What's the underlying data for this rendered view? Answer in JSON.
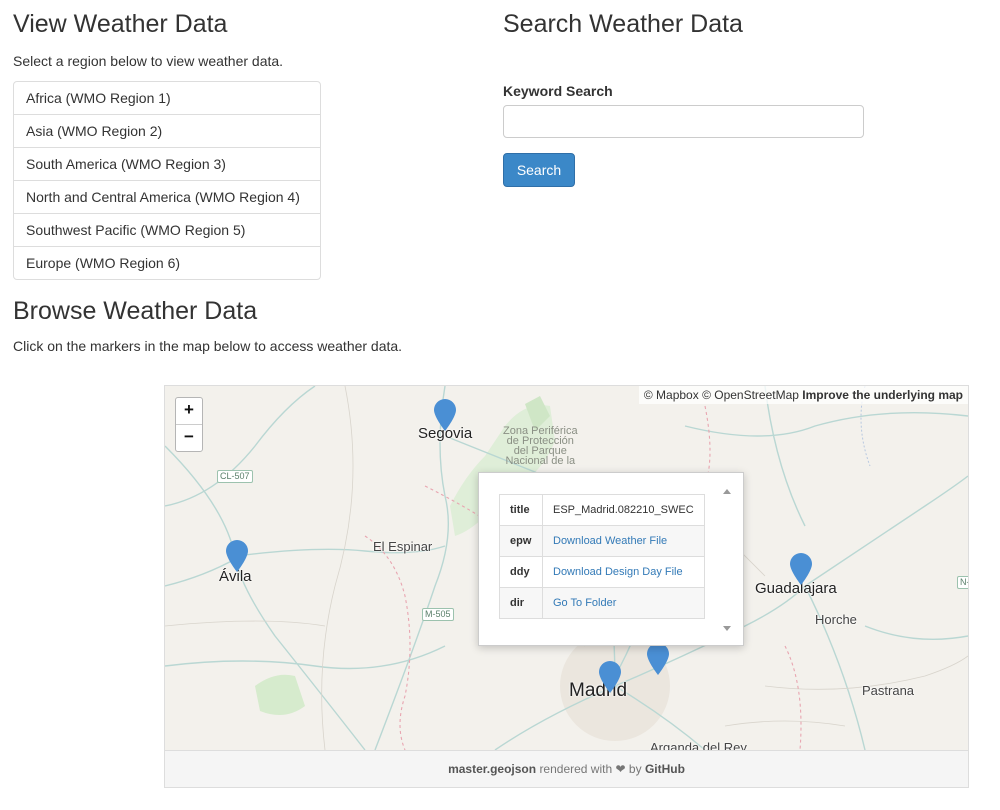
{
  "view": {
    "title": "View Weather Data",
    "subtitle": "Select a region below to view weather data.",
    "regions": [
      "Africa (WMO Region 1)",
      "Asia (WMO Region 2)",
      "South America (WMO Region 3)",
      "North and Central America (WMO Region 4)",
      "Southwest Pacific (WMO Region 5)",
      "Europe (WMO Region 6)"
    ]
  },
  "search": {
    "title": "Search Weather Data",
    "keyword_label": "Keyword Search",
    "input_value": "",
    "button_label": "Search"
  },
  "browse": {
    "title": "Browse Weather Data",
    "subtitle": "Click on the markers in the map below to access weather data."
  },
  "map": {
    "attribution_mapbox": "© Mapbox",
    "attribution_osm": "© OpenStreetMap",
    "attribution_improve": "Improve the underlying map",
    "zoom_in": "+",
    "zoom_out": "−",
    "cities": {
      "segovia": "Segovia",
      "avila": "Ávila",
      "el_espinar": "El Espinar",
      "guadalajara": "Guadalajara",
      "horche": "Horche",
      "madrid": "Madrid",
      "pastrana": "Pastrana",
      "arganda": "Arganda del Rey"
    },
    "park": [
      "Zona Periférica",
      "de Protección",
      "del Parque",
      "Nacional de la"
    ],
    "roads": [
      "CL-507",
      "M-505",
      "N-"
    ],
    "marker_color": "#4a8fd4",
    "popup": {
      "rows": [
        {
          "key": "title",
          "value": "ESP_Madrid.082210_SWEC"
        },
        {
          "key": "epw",
          "value": "Download Weather File"
        },
        {
          "key": "ddy",
          "value": "Download Design Day File"
        },
        {
          "key": "dir",
          "value": "Go To Folder"
        }
      ]
    },
    "footer": {
      "file": "master.geojson",
      "rendered": "rendered with",
      "heart_icon": "heart-icon",
      "by": "by",
      "github": "GitHub"
    }
  }
}
